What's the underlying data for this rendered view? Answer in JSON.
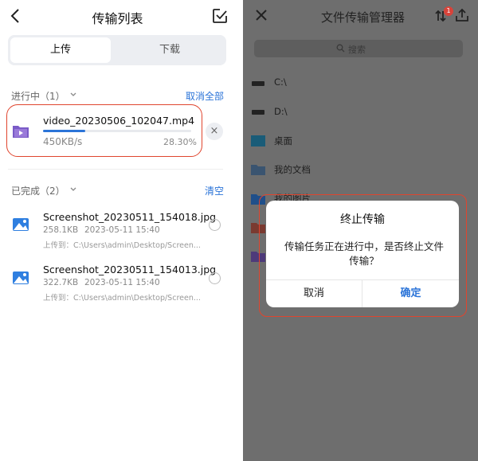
{
  "left": {
    "header": {
      "title": "传输列表"
    },
    "tabs": {
      "upload": "上传",
      "download": "下载"
    },
    "in_progress": {
      "section_title": "进行中（1）",
      "cancel_all": "取消全部",
      "item": {
        "name": "video_20230506_102047.mp4",
        "speed": "450KB/s",
        "percent_text": "28.30%",
        "progress": 0.283
      }
    },
    "completed": {
      "section_title": "已完成（2）",
      "clear": "清空",
      "items": [
        {
          "name": "Screenshot_20230511_154018.jpg",
          "size": "258.1KB",
          "date": "2023-05-11 15:40",
          "dest": "上传到：C:\\Users\\admin\\Desktop/Screen..."
        },
        {
          "name": "Screenshot_20230511_154013.jpg",
          "size": "322.7KB",
          "date": "2023-05-11 15:40",
          "dest": "上传到：C:\\Users\\admin\\Desktop/Screen..."
        }
      ]
    }
  },
  "right": {
    "header": {
      "title": "文件传输管理器",
      "badge": "1"
    },
    "search": {
      "placeholder": "搜索"
    },
    "items": [
      {
        "label": "C:\\",
        "icon": "drive-icon"
      },
      {
        "label": "D:\\",
        "icon": "drive-icon"
      },
      {
        "label": "桌面",
        "icon": "desktop-folder-icon"
      },
      {
        "label": "我的文档",
        "icon": "documents-folder-icon"
      },
      {
        "label": "我的图片",
        "icon": "pictures-folder-icon"
      },
      {
        "label": "",
        "icon": "music-folder-icon"
      },
      {
        "label": "",
        "icon": "videos-folder-icon"
      }
    ],
    "dialog": {
      "title": "终止传输",
      "message": "传输任务正在进行中，是否终止文件传输？",
      "cancel": "取消",
      "confirm": "确定"
    }
  },
  "colors": {
    "accent": "#2b74d8",
    "highlight": "#e0452e",
    "overlay": "#6e6e6e"
  }
}
